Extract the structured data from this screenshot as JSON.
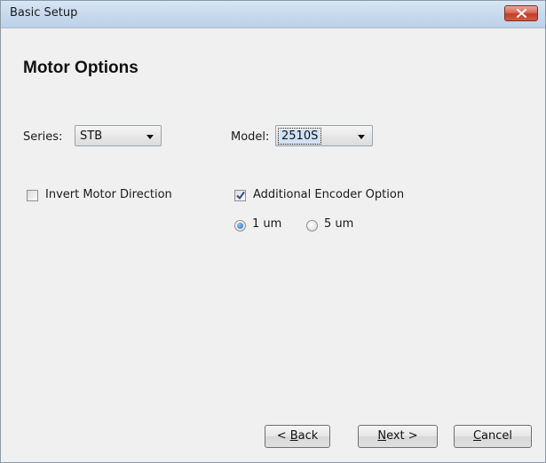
{
  "window": {
    "title": "Basic Setup"
  },
  "page": {
    "heading": "Motor Options"
  },
  "series": {
    "label": "Series:",
    "value": "STB"
  },
  "model": {
    "label": "Model:",
    "value": "2510S"
  },
  "options": {
    "invert_direction": {
      "label": "Invert Motor Direction",
      "checked": false
    },
    "additional_encoder": {
      "label": "Additional Encoder Option",
      "checked": true
    },
    "resolution": [
      {
        "label": "1 um",
        "selected": true
      },
      {
        "label": "5 um",
        "selected": false
      }
    ]
  },
  "buttons": {
    "back": {
      "prefix": "< ",
      "mnemonic": "B",
      "rest": "ack"
    },
    "next": {
      "mnemonic": "N",
      "rest": "ext >"
    },
    "cancel": {
      "mnemonic": "C",
      "rest": "ancel"
    }
  },
  "colors": {
    "titlebar": "#c9dbee",
    "close_button": "#c43c25",
    "dialog_background": "#f0f0f0",
    "accent": "#1f6fc4"
  },
  "icons": {
    "close": "close-icon",
    "dropdown": "chevron-down-icon",
    "check": "checkmark-icon"
  }
}
